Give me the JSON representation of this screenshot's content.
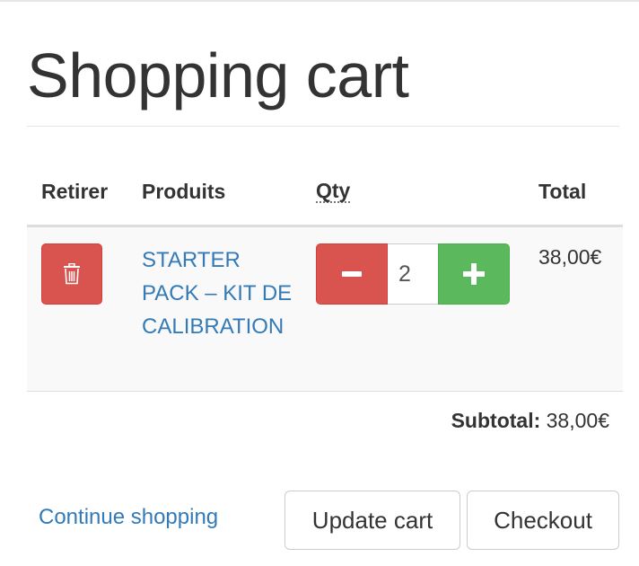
{
  "page": {
    "title": "Shopping cart"
  },
  "table": {
    "headers": {
      "remove": "Retirer",
      "product": "Produits",
      "qty": "Qty",
      "total": "Total"
    },
    "rows": [
      {
        "product_name": "STARTER PACK – KIT DE CALIBRATION",
        "quantity": "2",
        "total": "38,00€",
        "remove_icon": "trash-icon",
        "minus_icon": "minus-icon",
        "plus_icon": "plus-icon"
      }
    ]
  },
  "summary": {
    "subtotal_label": "Subtotal:",
    "subtotal_value": "38,00€"
  },
  "actions": {
    "continue_label": "Continue shopping",
    "update_label": "Update cart",
    "checkout_label": "Checkout"
  },
  "colors": {
    "danger": "#d9534f",
    "success": "#5cb85c",
    "link": "#337ab7",
    "row_background": "#f9f9f9"
  }
}
